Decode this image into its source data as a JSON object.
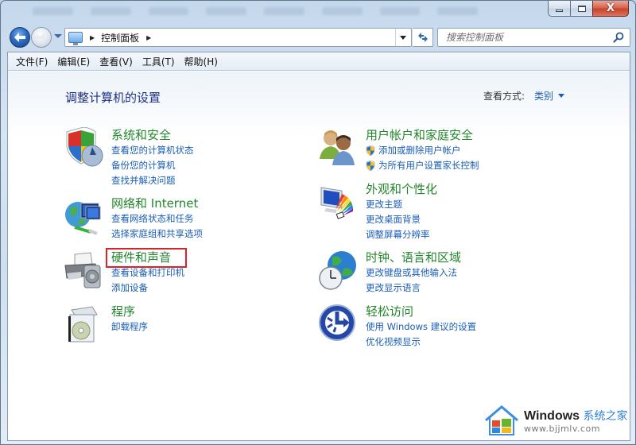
{
  "window": {
    "caption": {
      "minimize_icon": "minimize-icon",
      "maximize_icon": "maximize-icon",
      "close_icon": "close-icon",
      "close_glyph": "X"
    }
  },
  "nav": {
    "back_icon": "back-arrow-icon",
    "forward_icon": "forward-arrow-icon",
    "address": {
      "crumbs": [
        "控制面板"
      ]
    },
    "refresh_icon": "refresh-icon",
    "search": {
      "placeholder": "搜索控制面板",
      "value": ""
    }
  },
  "menu": [
    {
      "label": "文件(F)"
    },
    {
      "label": "编辑(E)"
    },
    {
      "label": "查看(V)"
    },
    {
      "label": "工具(T)"
    },
    {
      "label": "帮助(H)"
    }
  ],
  "main": {
    "title": "调整计算机的设置",
    "view_by": {
      "label": "查看方式:",
      "value": "类别"
    },
    "categories": [
      {
        "icon": "security-shield-icon",
        "title": "系统和安全",
        "highlighted": false,
        "links": [
          "查看您的计算机状态",
          "备份您的计算机",
          "查找并解决问题"
        ]
      },
      {
        "icon": "network-globe-icon",
        "title": "网络和 Internet",
        "highlighted": false,
        "links": [
          "查看网络状态和任务",
          "选择家庭组和共享选项"
        ]
      },
      {
        "icon": "printer-speaker-icon",
        "title": "硬件和声音",
        "highlighted": true,
        "links": [
          "查看设备和打印机",
          "添加设备"
        ]
      },
      {
        "icon": "program-box-icon",
        "title": "程序",
        "highlighted": false,
        "links": [
          "卸载程序"
        ]
      },
      {
        "icon": "users-icon",
        "title": "用户帐户和家庭安全",
        "highlighted": false,
        "links": [
          "添加或删除用户帐户",
          "为所有用户设置家长控制"
        ],
        "links_have_shield": true
      },
      {
        "icon": "monitor-palette-icon",
        "title": "外观和个性化",
        "highlighted": false,
        "links": [
          "更改主题",
          "更改桌面背景",
          "调整屏幕分辨率"
        ]
      },
      {
        "icon": "globe-clock-icon",
        "title": "时钟、语言和区域",
        "highlighted": false,
        "links": [
          "更改键盘或其他输入法",
          "更改显示语言"
        ]
      },
      {
        "icon": "ease-of-access-icon",
        "title": "轻松访问",
        "highlighted": false,
        "links": [
          "使用 Windows 建议的设置",
          "优化视频显示"
        ]
      }
    ]
  },
  "watermark": {
    "brand": "Windows",
    "brand_cn": "系统之家",
    "url": "www.bjjmlv.com"
  },
  "colors": {
    "category_title": "#23862c",
    "link": "#1a5db5",
    "page_title": "#1e3287",
    "highlight_box": "#d9222a"
  }
}
